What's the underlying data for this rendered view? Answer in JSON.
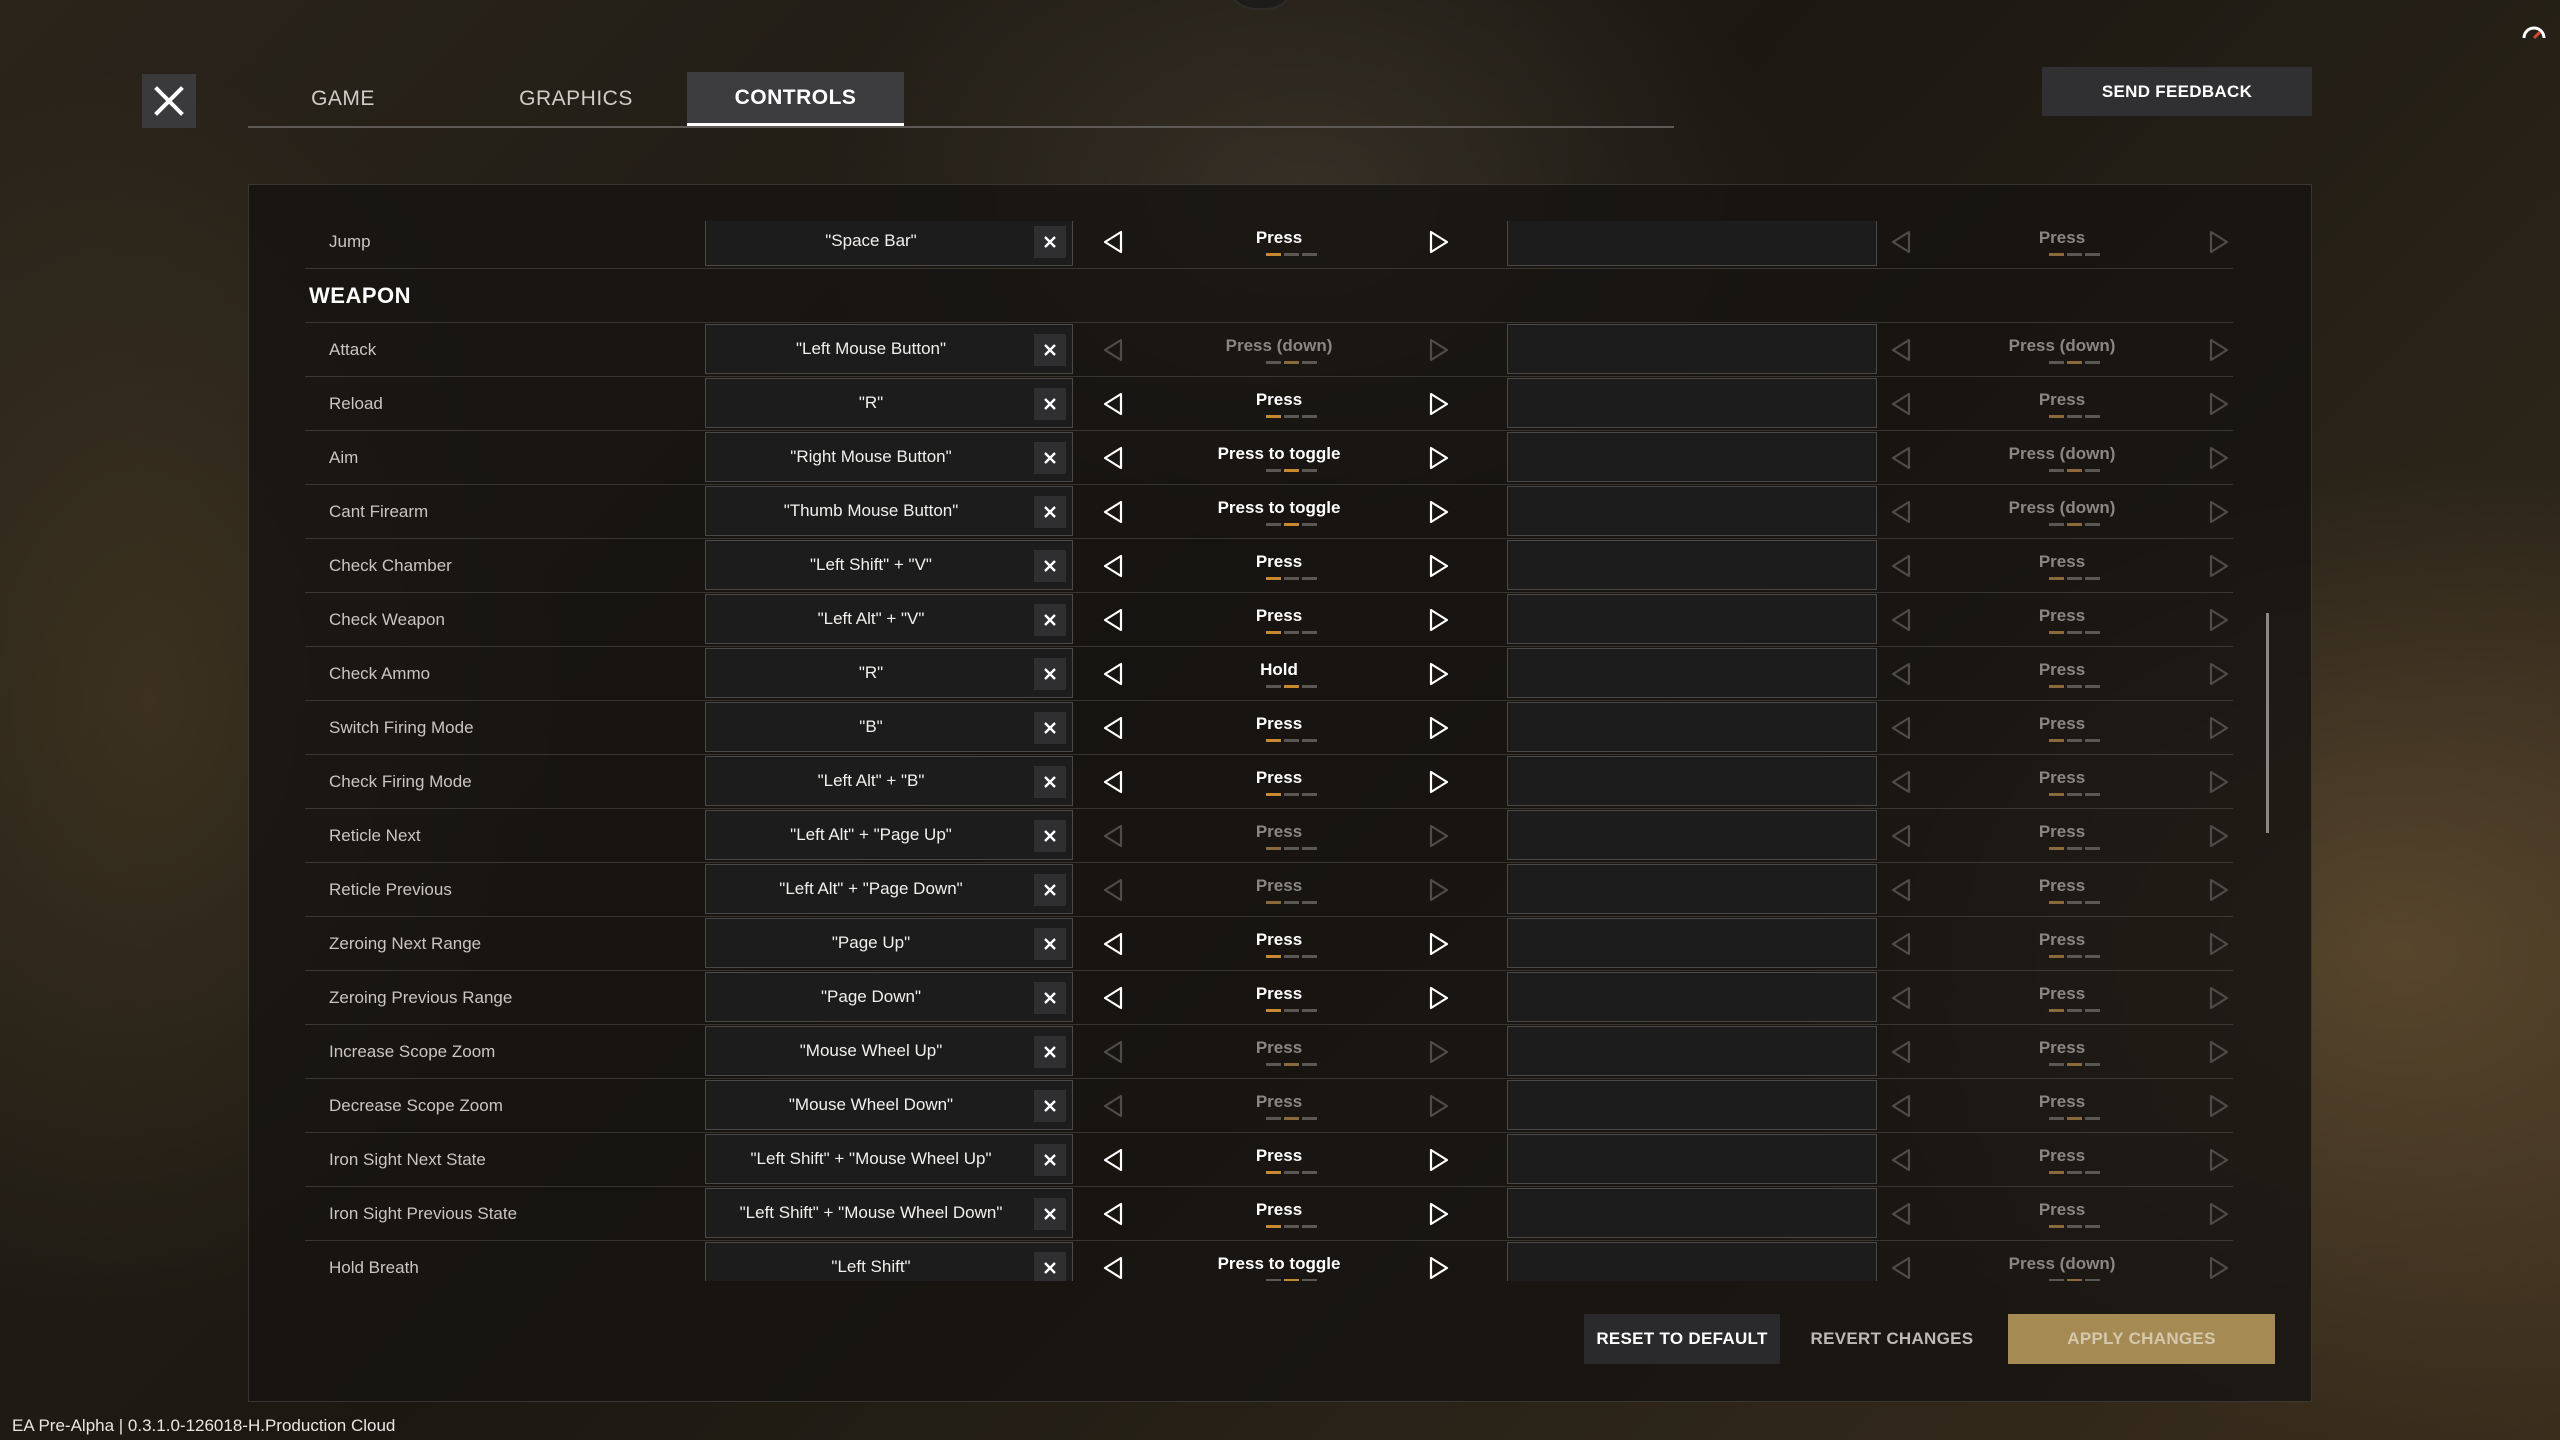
{
  "header": {
    "tabs": [
      {
        "label": "GAME",
        "active": false
      },
      {
        "label": "GRAPHICS",
        "active": false
      },
      {
        "label": "CONTROLS",
        "active": true
      }
    ],
    "feedback_label": "SEND FEEDBACK"
  },
  "controls": {
    "jump": {
      "label": "Jump",
      "binding": "\"Space Bar\"",
      "mode": "Press",
      "mode_enabled": true,
      "mode_index": 0,
      "alt_mode": "Press",
      "alt_mode_index": 0
    },
    "section_title": "WEAPON",
    "rows": [
      {
        "label": "Attack",
        "binding": "\"Left Mouse Button\"",
        "mode": "Press (down)",
        "mode_enabled": false,
        "mode_index": 1,
        "alt_mode": "Press (down)",
        "alt_mode_index": 1
      },
      {
        "label": "Reload",
        "binding": "\"R\"",
        "mode": "Press",
        "mode_enabled": true,
        "mode_index": 0,
        "alt_mode": "Press",
        "alt_mode_index": 0
      },
      {
        "label": "Aim",
        "binding": "\"Right Mouse Button\"",
        "mode": "Press to toggle",
        "mode_enabled": true,
        "mode_index": 1,
        "alt_mode": "Press (down)",
        "alt_mode_index": 1
      },
      {
        "label": "Cant Firearm",
        "binding": "\"Thumb Mouse Button\"",
        "mode": "Press to toggle",
        "mode_enabled": true,
        "mode_index": 1,
        "alt_mode": "Press (down)",
        "alt_mode_index": 1
      },
      {
        "label": "Check Chamber",
        "binding": "\"Left Shift\" + \"V\"",
        "mode": "Press",
        "mode_enabled": true,
        "mode_index": 0,
        "alt_mode": "Press",
        "alt_mode_index": 0
      },
      {
        "label": "Check Weapon",
        "binding": "\"Left Alt\" + \"V\"",
        "mode": "Press",
        "mode_enabled": true,
        "mode_index": 0,
        "alt_mode": "Press",
        "alt_mode_index": 0
      },
      {
        "label": "Check Ammo",
        "binding": "\"R\"",
        "mode": "Hold",
        "mode_enabled": true,
        "mode_index": 1,
        "alt_mode": "Press",
        "alt_mode_index": 0
      },
      {
        "label": "Switch Firing Mode",
        "binding": "\"B\"",
        "mode": "Press",
        "mode_enabled": true,
        "mode_index": 0,
        "alt_mode": "Press",
        "alt_mode_index": 0
      },
      {
        "label": "Check Firing Mode",
        "binding": "\"Left Alt\" + \"B\"",
        "mode": "Press",
        "mode_enabled": true,
        "mode_index": 0,
        "alt_mode": "Press",
        "alt_mode_index": 0
      },
      {
        "label": "Reticle Next",
        "binding": "\"Left Alt\" + \"Page Up\"",
        "mode": "Press",
        "mode_enabled": false,
        "mode_index": 0,
        "alt_mode": "Press",
        "alt_mode_index": 0
      },
      {
        "label": "Reticle Previous",
        "binding": "\"Left Alt\" + \"Page Down\"",
        "mode": "Press",
        "mode_enabled": false,
        "mode_index": 0,
        "alt_mode": "Press",
        "alt_mode_index": 0
      },
      {
        "label": "Zeroing Next Range",
        "binding": "\"Page Up\"",
        "mode": "Press",
        "mode_enabled": true,
        "mode_index": 0,
        "alt_mode": "Press",
        "alt_mode_index": 0
      },
      {
        "label": "Zeroing Previous Range",
        "binding": "\"Page Down\"",
        "mode": "Press",
        "mode_enabled": true,
        "mode_index": 0,
        "alt_mode": "Press",
        "alt_mode_index": 0
      },
      {
        "label": "Increase Scope Zoom",
        "binding": "\"Mouse Wheel Up\"",
        "mode": "Press",
        "mode_enabled": false,
        "mode_index": 1,
        "alt_mode": "Press",
        "alt_mode_index": 1
      },
      {
        "label": "Decrease Scope Zoom",
        "binding": "\"Mouse Wheel Down\"",
        "mode": "Press",
        "mode_enabled": false,
        "mode_index": 1,
        "alt_mode": "Press",
        "alt_mode_index": 1
      },
      {
        "label": "Iron Sight Next State",
        "binding": "\"Left Shift\" + \"Mouse Wheel Up\"",
        "mode": "Press",
        "mode_enabled": true,
        "mode_index": 0,
        "alt_mode": "Press",
        "alt_mode_index": 0
      },
      {
        "label": "Iron Sight Previous State",
        "binding": "\"Left Shift\" + \"Mouse Wheel Down\"",
        "mode": "Press",
        "mode_enabled": true,
        "mode_index": 0,
        "alt_mode": "Press",
        "alt_mode_index": 0
      },
      {
        "label": "Hold Breath",
        "binding": "\"Left Shift\"",
        "mode": "Press to toggle",
        "mode_enabled": true,
        "mode_index": 1,
        "alt_mode": "Press (down)",
        "alt_mode_index": 1
      }
    ]
  },
  "footer": {
    "reset_label": "RESET TO DEFAULT",
    "revert_label": "REVERT CHANGES",
    "apply_label": "APPLY CHANGES"
  },
  "version": "EA Pre-Alpha | 0.3.1.0-126018-H.Production Cloud",
  "colors": {
    "accent": "#c8892e",
    "apply_button": "#a68a53",
    "panel_bg": "#161411",
    "field_bg": "#1c1c1c"
  },
  "icons": {
    "close": "close-icon",
    "arrow_left": "arrow-left-icon",
    "arrow_right": "arrow-right-icon",
    "clear": "clear-binding-icon",
    "corner": "network-status-icon"
  }
}
